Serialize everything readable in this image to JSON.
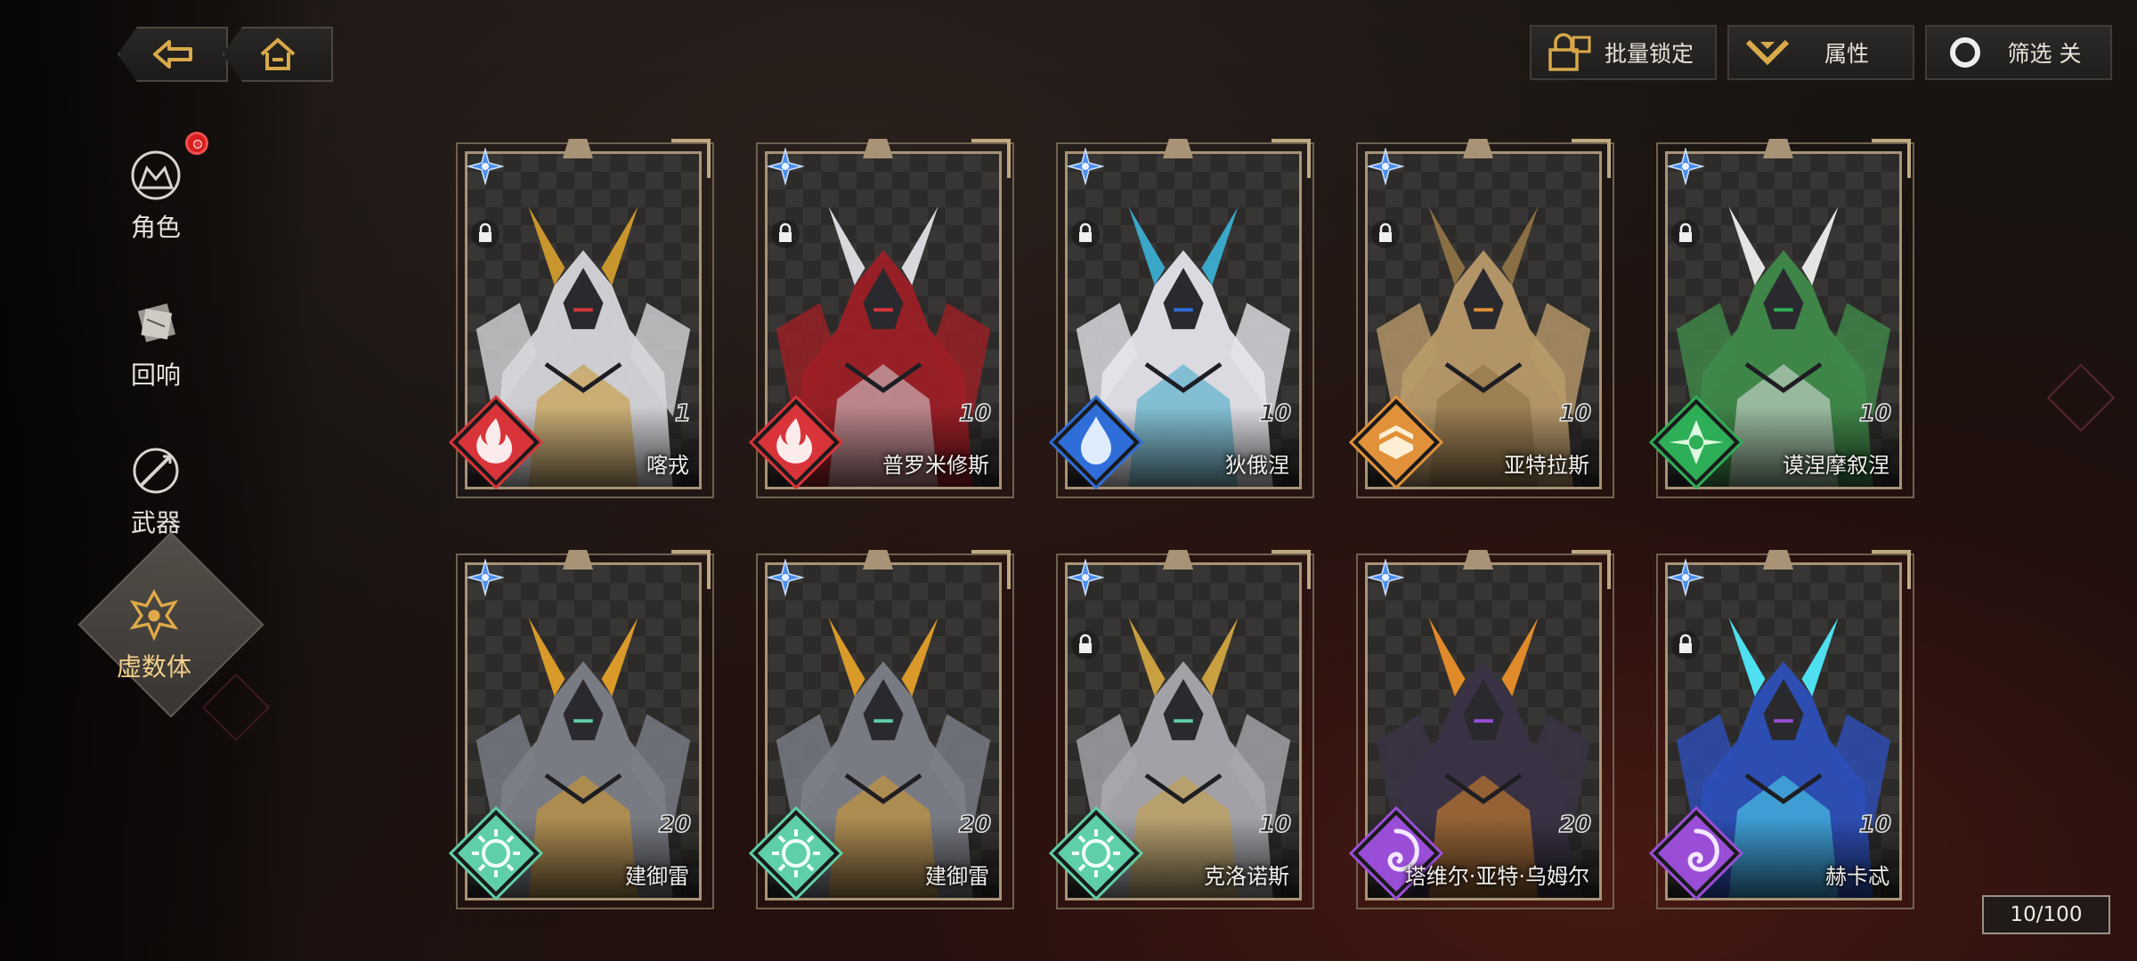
{
  "nav": {
    "back_icon": "back-arrow-icon",
    "home_icon": "home-icon"
  },
  "toolbar": {
    "batch_lock": {
      "label": "批量锁定",
      "icon": "batch-lock-icon"
    },
    "attribute": {
      "label": "属性",
      "icon": "attribute-chevron-icon"
    },
    "filter": {
      "label": "筛选 关",
      "icon": "filter-circle-icon"
    }
  },
  "sidebar": {
    "items": [
      {
        "label": "角色",
        "icon": "character-icon",
        "active": false,
        "badge": true
      },
      {
        "label": "回响",
        "icon": "echo-card-icon",
        "active": false,
        "badge": false
      },
      {
        "label": "武器",
        "icon": "weapon-icon",
        "active": false,
        "badge": false
      },
      {
        "label": "虚数体",
        "icon": "imaginary-body-icon",
        "active": true,
        "badge": false
      }
    ]
  },
  "cards": [
    {
      "name": "喀戎",
      "level": "1",
      "element": "fire",
      "locked": true,
      "colors": {
        "elem": "#d8343a",
        "body": "#d6d6da",
        "accent": "#c8962c"
      }
    },
    {
      "name": "普罗米修斯",
      "level": "10",
      "element": "fire",
      "locked": true,
      "colors": {
        "elem": "#d8343a",
        "body": "#9c1f26",
        "accent": "#d8d8dc"
      }
    },
    {
      "name": "狄俄涅",
      "level": "10",
      "element": "water",
      "locked": true,
      "colors": {
        "elem": "#2f6ed8",
        "body": "#e4e4ea",
        "accent": "#3aa7c8"
      }
    },
    {
      "name": "亚特拉斯",
      "level": "10",
      "element": "earth",
      "locked": true,
      "colors": {
        "elem": "#e0913a",
        "body": "#b89a6a",
        "accent": "#8a6e44"
      }
    },
    {
      "name": "谟涅摩叙涅",
      "level": "10",
      "element": "wind",
      "locked": true,
      "colors": {
        "elem": "#2fae58",
        "body": "#3f8a4a",
        "accent": "#e4e4e4"
      }
    },
    {
      "name": "建御雷",
      "level": "20",
      "element": "light",
      "locked": false,
      "colors": {
        "elem": "#5fcfa8",
        "body": "#7c7f88",
        "accent": "#d99a2a"
      }
    },
    {
      "name": "建御雷",
      "level": "20",
      "element": "light",
      "locked": false,
      "colors": {
        "elem": "#5fcfa8",
        "body": "#7c7f88",
        "accent": "#d99a2a"
      }
    },
    {
      "name": "克洛诺斯",
      "level": "10",
      "element": "light",
      "locked": true,
      "colors": {
        "elem": "#5fcfa8",
        "body": "#a8a8ae",
        "accent": "#c8a040"
      }
    },
    {
      "name": "塔维尔·亚特·乌姆尔",
      "level": "20",
      "element": "void",
      "locked": false,
      "colors": {
        "elem": "#9a4ed8",
        "body": "#3a3346",
        "accent": "#e08a2a"
      }
    },
    {
      "name": "赫卡忒",
      "level": "10",
      "element": "void",
      "locked": true,
      "colors": {
        "elem": "#9a4ed8",
        "body": "#2c4fb8",
        "accent": "#4fe0f0"
      }
    }
  ],
  "inventory": {
    "count": "10/100"
  }
}
